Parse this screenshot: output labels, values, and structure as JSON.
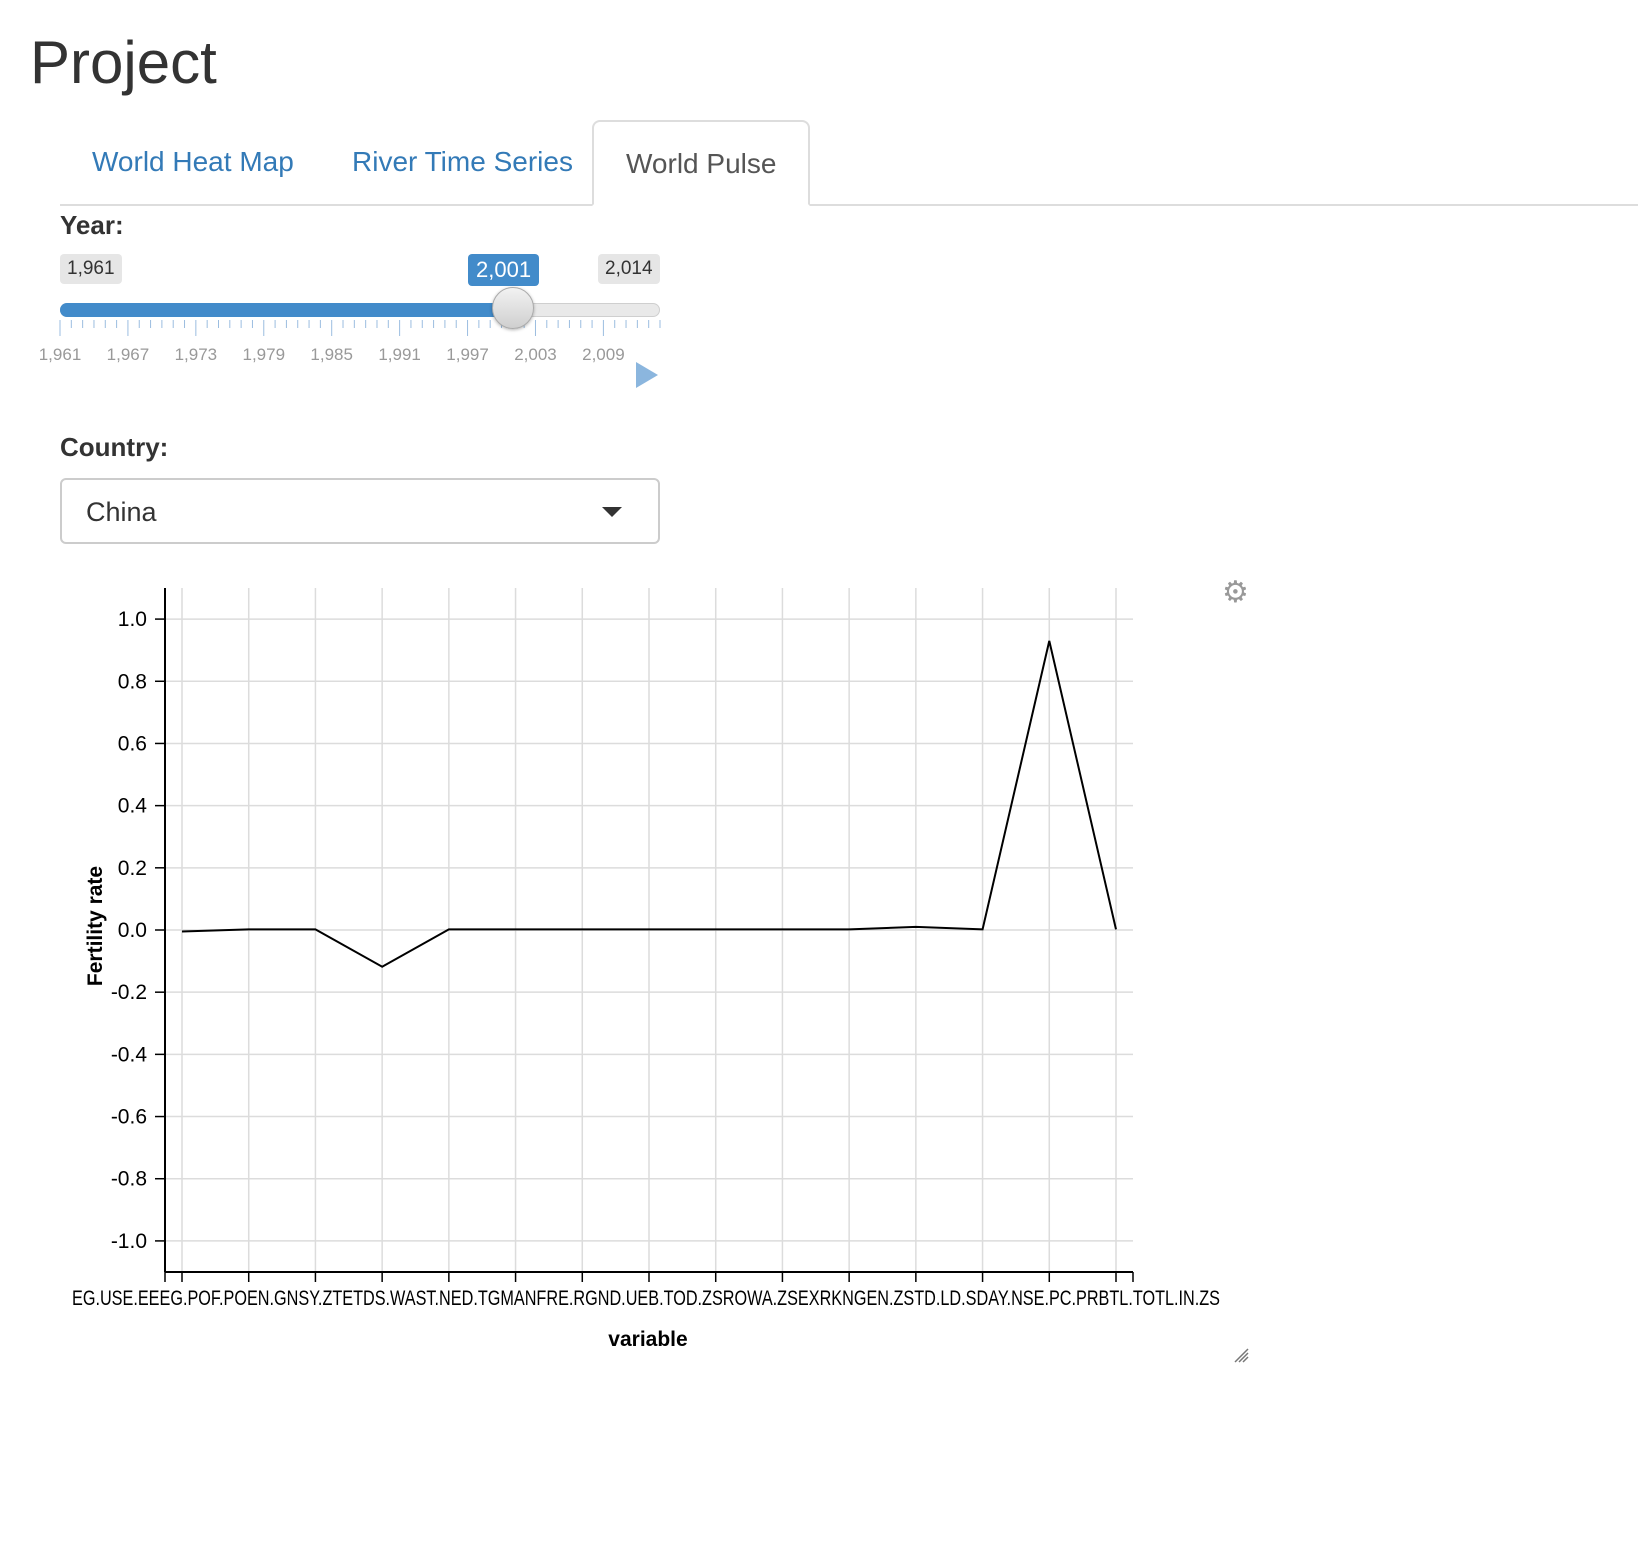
{
  "page": {
    "title": "Project"
  },
  "tabs": [
    {
      "label": "World Heat Map",
      "active": false
    },
    {
      "label": "River Time Series",
      "active": false
    },
    {
      "label": "World Pulse",
      "active": true
    }
  ],
  "year": {
    "label": "Year:",
    "min_label": "1,961",
    "max_label": "2,014",
    "value_label": "2,001",
    "min": 1961,
    "max": 2014,
    "value": 2001,
    "tick_labels": [
      "1,961",
      "1,967",
      "1,973",
      "1,979",
      "1,985",
      "1,991",
      "1,997",
      "2,003",
      "2,009"
    ]
  },
  "country": {
    "label": "Country:",
    "selected": "China"
  },
  "icons": {
    "settings": "gear-icon",
    "resize": "resize-handle-icon",
    "play": "play-icon",
    "dropdown": "caret-down-icon"
  },
  "chart_data": {
    "type": "line",
    "xlabel": "variable",
    "ylabel": "Fertility rate",
    "ylim": [
      -1.1,
      1.1
    ],
    "yticks": [
      "1.0",
      "0.8",
      "0.6",
      "0.4",
      "0.2",
      "0.0",
      "-0.2",
      "-0.4",
      "-0.6",
      "-0.8",
      "-1.0"
    ],
    "x_axis_text": "EG.USE.EEEG.POF.POEN.GNSY.ZTETDS.WAST.NED.TGMANFRE.RGND.UEB.TOD.ZSROWA.ZSEXRKNGEN.ZSTD.LD.SDAY.NSE.PC.PRBTL.TOTL.IN.ZS",
    "grid": true,
    "series": [
      {
        "values": [
          -0.005,
          0.002,
          0.002,
          -0.118,
          0.002,
          0.002,
          0.002,
          0.002,
          0.002,
          0.002,
          0.002,
          0.01,
          0.002,
          0.93,
          0.002
        ]
      }
    ],
    "line_color": "#000000"
  }
}
